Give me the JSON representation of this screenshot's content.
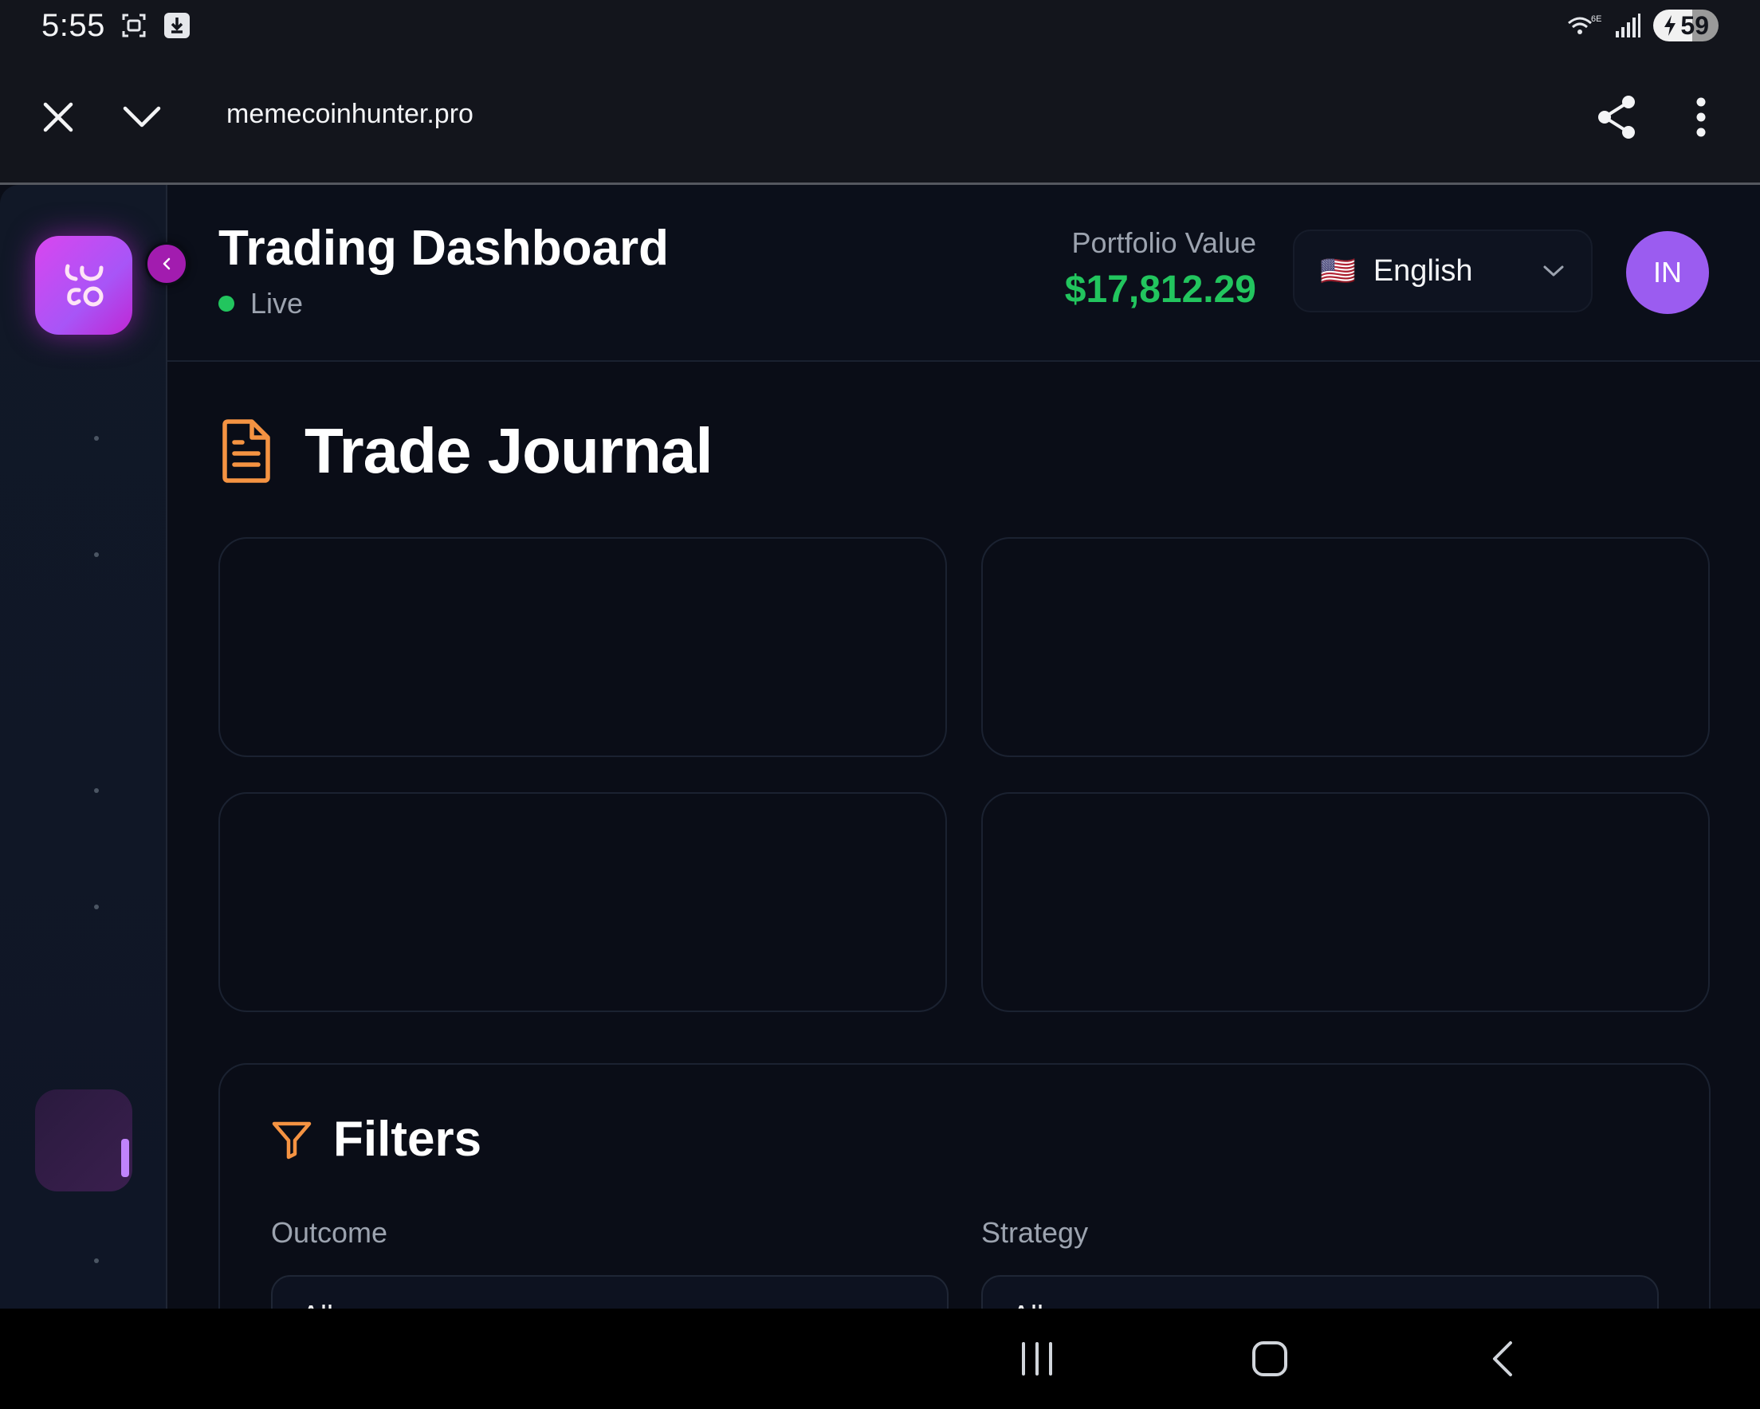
{
  "status_bar": {
    "time": "5:55",
    "network": "6E",
    "battery": "59",
    "icons": [
      "screenshot-icon",
      "download-icon",
      "wifi-icon",
      "signal-icon",
      "battery-icon"
    ]
  },
  "browser": {
    "url": "memecoinhunter.pro",
    "icons": [
      "close-icon",
      "chevron-down-icon",
      "share-icon",
      "more-vert-icon"
    ]
  },
  "header": {
    "title": "Trading Dashboard",
    "status": "Live",
    "portfolio_label": "Portfolio Value",
    "portfolio_value": "$17,812.29",
    "language": {
      "flag": "🇺🇸",
      "label": "English"
    },
    "avatar_initials": "IN"
  },
  "page": {
    "title": "Trade Journal",
    "stat_cards": 4
  },
  "filters": {
    "title": "Filters",
    "outcome": {
      "label": "Outcome",
      "value": "All"
    },
    "strategy": {
      "label": "Strategy",
      "value": "All"
    }
  },
  "colors": {
    "accent": "#a855f7",
    "brand_gradient_start": "#d946ef",
    "positive": "#22c55e",
    "icon_orange": "#f59342",
    "background": "#0a0d17"
  }
}
